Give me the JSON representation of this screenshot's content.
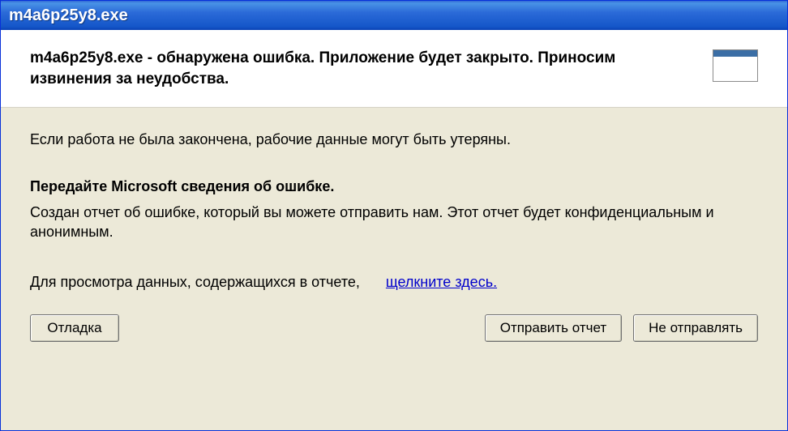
{
  "titlebar": {
    "title": "m4a6p25y8.exe"
  },
  "header": {
    "message": "m4a6p25y8.exe - обнаружена ошибка. Приложение будет закрыто. Приносим извинения за неудобства."
  },
  "body": {
    "warning": "Если работа не была закончена, рабочие данные могут быть утеряны.",
    "report_heading": "Передайте Microsoft сведения об ошибке.",
    "report_desc": "Создан отчет об ошибке, который вы можете отправить нам. Этот отчет будет конфиденциальным и анонимным.",
    "view_label": "Для просмотра данных, содержащихся в отчете,",
    "view_link": "щелкните здесь."
  },
  "buttons": {
    "debug": "Отладка",
    "send": "Отправить отчет",
    "dont_send": "Не отправлять"
  }
}
